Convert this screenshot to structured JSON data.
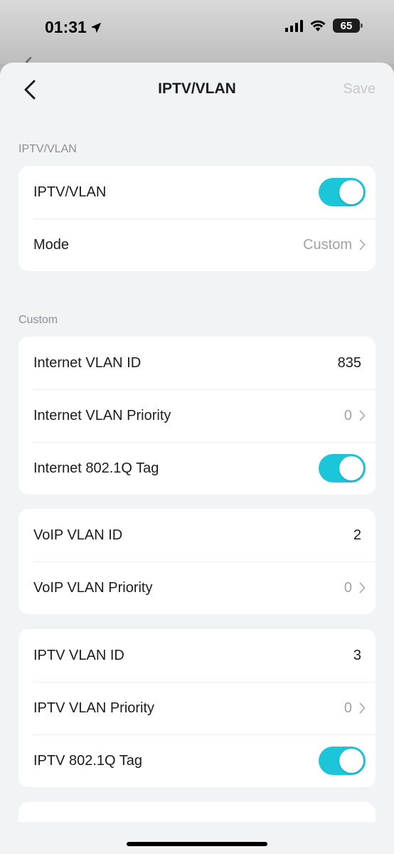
{
  "status_bar": {
    "time": "01:31",
    "battery": "65",
    "location_icon": "location-arrow-icon",
    "signal_icon": "cellular-signal-icon",
    "wifi_icon": "wifi-icon"
  },
  "nav": {
    "back_icon": "chevron-left-icon",
    "title": "IPTV/VLAN",
    "save_label": "Save"
  },
  "sections": {
    "iptv_vlan": {
      "label": "IPTV/VLAN",
      "rows": {
        "enable": {
          "label": "IPTV/VLAN",
          "enabled": true
        },
        "mode": {
          "label": "Mode",
          "value": "Custom"
        }
      }
    },
    "custom": {
      "label": "Custom",
      "internet": {
        "vlan_id": {
          "label": "Internet VLAN ID",
          "value": "835"
        },
        "priority": {
          "label": "Internet VLAN Priority",
          "value": "0"
        },
        "tag": {
          "label": "Internet 802.1Q Tag",
          "enabled": true
        }
      },
      "voip": {
        "vlan_id": {
          "label": "VoIP VLAN ID",
          "value": "2"
        },
        "priority": {
          "label": "VoIP VLAN Priority",
          "value": "0"
        }
      },
      "iptv": {
        "vlan_id": {
          "label": "IPTV VLAN ID",
          "value": "3"
        },
        "priority": {
          "label": "IPTV VLAN Priority",
          "value": "0"
        },
        "tag": {
          "label": "IPTV 802.1Q Tag",
          "enabled": true
        }
      },
      "partial_row": {
        "enabled": false
      }
    }
  },
  "colors": {
    "accent": "#1cc6d9",
    "background": "#f2f3f5",
    "card": "#ffffff",
    "muted_text": "#8e8e93"
  }
}
